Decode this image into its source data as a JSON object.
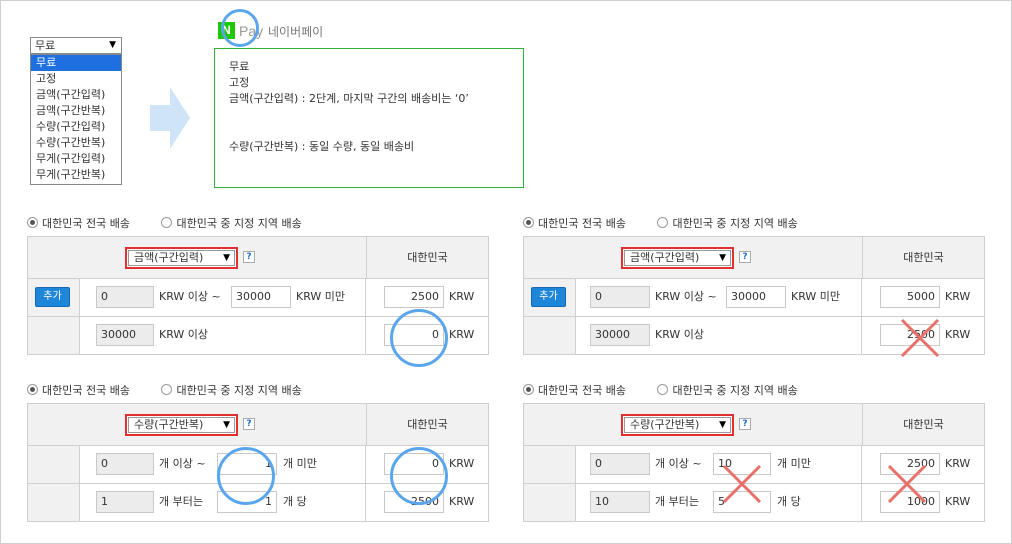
{
  "dropdown": {
    "selected": "무료",
    "options": [
      "무료",
      "고정",
      "금액(구간입력)",
      "금액(구간반복)",
      "수량(구간입력)",
      "수량(구간반복)",
      "무게(구간입력)",
      "무게(구간반복)"
    ]
  },
  "npay": {
    "logo_letter": "N",
    "pay_text": "Pay",
    "name": "네이버페이"
  },
  "npay_box": {
    "lines": [
      "무료",
      "고정",
      "금액(구간입력) : 2단계, 마지막 구간의 배송비는 ‘0’",
      "",
      "",
      "수량(구간반복) : 동일 수량, 동일 배송비"
    ]
  },
  "panels": [
    {
      "radio_nationwide": "대한민국 전국 배송",
      "radio_region": "대한민국 중 지정 지역 배송",
      "select_value": "금액(구간입력)",
      "help": "?",
      "col_header": "대한민국",
      "add_button": "추가",
      "row1": {
        "from": "0",
        "t1": "KRW 이상 ~",
        "to": "30000",
        "t2": "KRW 미만",
        "fee": "2500",
        "unit": "KRW"
      },
      "row2": {
        "from": "30000",
        "t1": "KRW 이상",
        "fee": "0",
        "unit": "KRW"
      }
    },
    {
      "radio_nationwide": "대한민국 전국 배송",
      "radio_region": "대한민국 중 지정 지역 배송",
      "select_value": "금액(구간입력)",
      "help": "?",
      "col_header": "대한민국",
      "add_button": "추가",
      "row1": {
        "from": "0",
        "t1": "KRW 이상 ~",
        "to": "30000",
        "t2": "KRW 미만",
        "fee": "5000",
        "unit": "KRW"
      },
      "row2": {
        "from": "30000",
        "t1": "KRW 이상",
        "fee": "2500",
        "unit": "KRW"
      }
    },
    {
      "radio_nationwide": "대한민국 전국 배송",
      "radio_region": "대한민국 중 지정 지역 배송",
      "select_value": "수량(구간반복)",
      "help": "?",
      "col_header": "대한민국",
      "row1": {
        "from": "0",
        "t1": "개 이상 ~",
        "to": "1",
        "t2": "개 미만",
        "fee": "0",
        "unit": "KRW"
      },
      "row2": {
        "from": "1",
        "t1": "개 부터는",
        "to": "1",
        "t2": "개 당",
        "fee": "2500",
        "unit": "KRW"
      }
    },
    {
      "radio_nationwide": "대한민국 전국 배송",
      "radio_region": "대한민국 중 지정 지역 배송",
      "select_value": "수량(구간반복)",
      "help": "?",
      "col_header": "대한민국",
      "row1": {
        "from": "0",
        "t1": "개 이상 ~",
        "to": "10",
        "t2": "개 미만",
        "fee": "2500",
        "unit": "KRW"
      },
      "row2": {
        "from": "10",
        "t1": "개 부터는",
        "to": "5",
        "t2": "개 당",
        "fee": "1000",
        "unit": "KRW"
      }
    }
  ],
  "colors": {
    "accent_blue": "#1e70e0",
    "npay_green": "#1ec800",
    "circle_blue": "#5aa6ec",
    "cross_red": "#e8706a",
    "box_green": "#36b336"
  }
}
